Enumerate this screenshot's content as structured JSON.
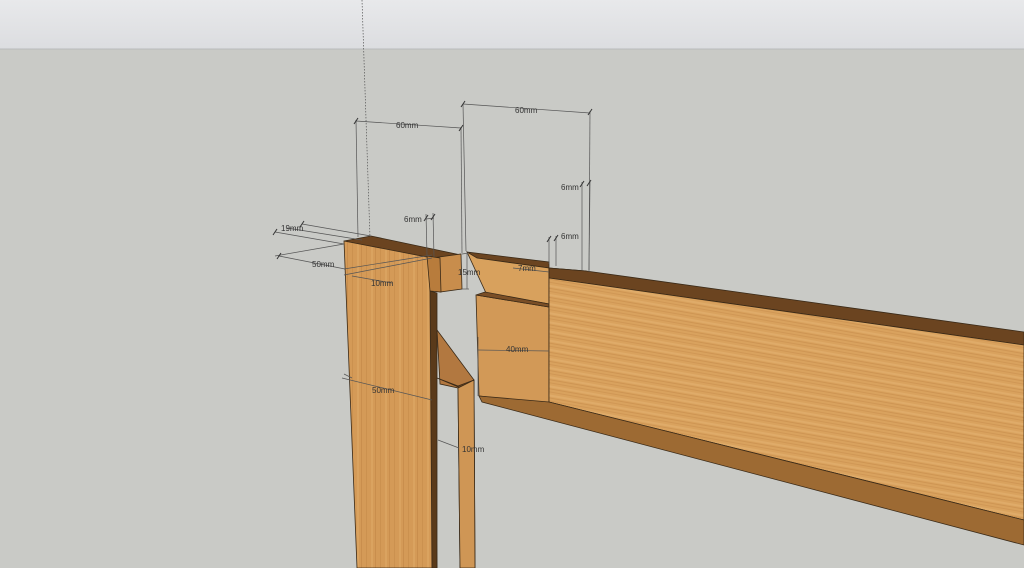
{
  "viewport": {
    "sky_color": "#e4e5e7",
    "ground_color": "#c9cac6"
  },
  "wood": {
    "face_light": "#d9a25e",
    "face_mid": "#cc9150",
    "face_dark": "#9d6a33",
    "top_dark": "#6b4420",
    "edge_line": "#3a2a18"
  },
  "dimensions": {
    "d_19": "19mm",
    "d_50_top": "50mm",
    "d_10_top": "10mm",
    "d_60_left": "60mm",
    "d_6_left": "6mm",
    "d_15": "15mm",
    "d_60_right": "60mm",
    "d_6_upper": "6mm",
    "d_6_lower": "6mm",
    "d_7": "7mm",
    "d_40": "40mm",
    "d_50_front": "50mm",
    "d_10_lower": "10mm"
  }
}
